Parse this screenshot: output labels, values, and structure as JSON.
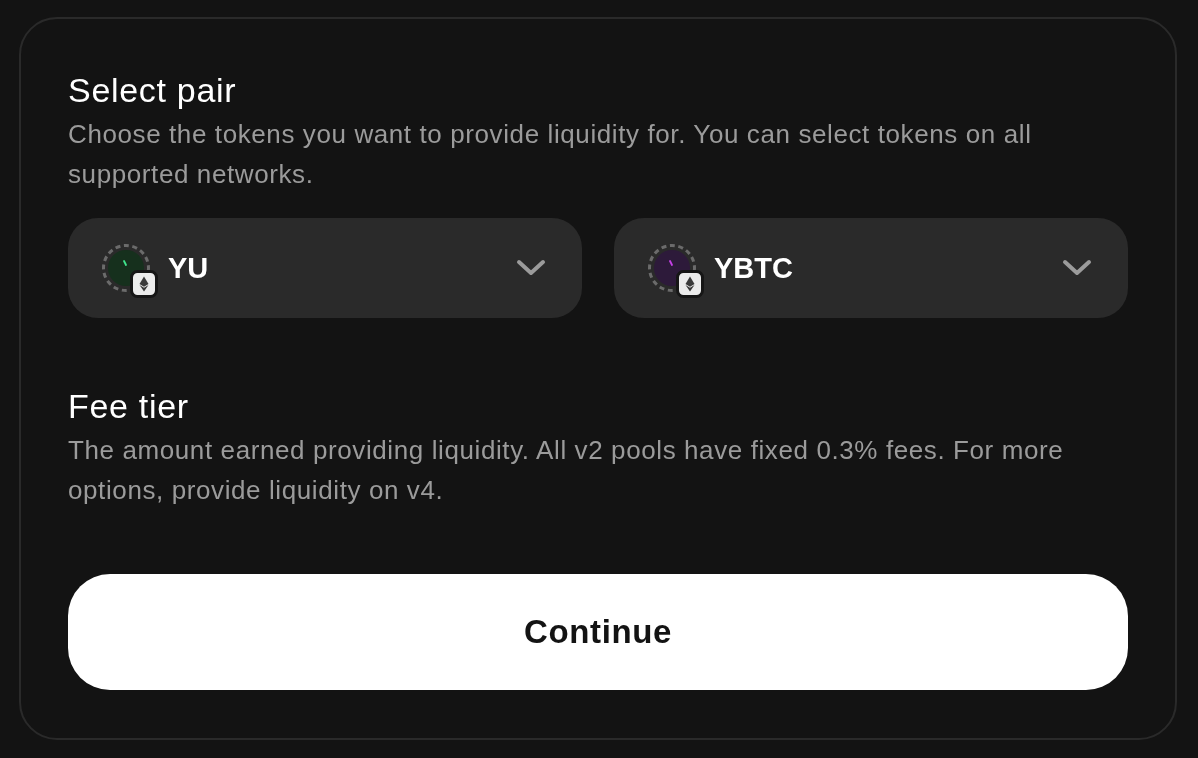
{
  "sections": [
    {
      "kind": "pair",
      "title": "Select pair",
      "description": "Choose the tokens you want to provide liquidity for. You can select tokens on all supported networks.",
      "tokens": [
        {
          "symbol": "YU",
          "color": "#16301d"
        },
        {
          "symbol": "YBTC",
          "color": "#2d1a3a"
        }
      ]
    },
    {
      "kind": "fee",
      "title": "Fee tier",
      "description": "The amount earned providing liquidity. All v2 pools have fixed 0.3% fees. For more options, provide liquidity on v4."
    }
  ],
  "primary_button": {
    "label": "Continue"
  }
}
